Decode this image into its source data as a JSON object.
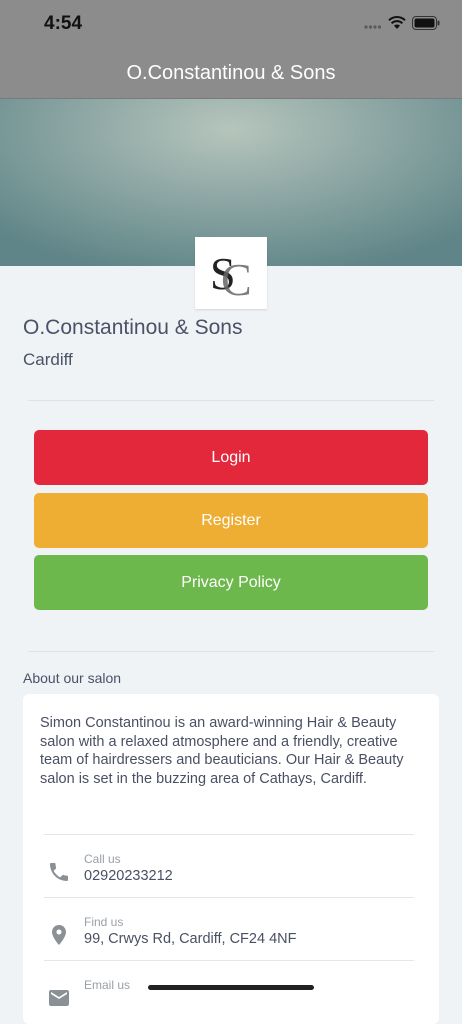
{
  "status": {
    "time": "4:54"
  },
  "header": {
    "title": "O.Constantinou & Sons"
  },
  "salon": {
    "name": "O.Constantinou & Sons",
    "city": "Cardiff",
    "logo_initials": "SC"
  },
  "buttons": {
    "login": {
      "label": "Login",
      "color": "#e3283c"
    },
    "register": {
      "label": "Register",
      "color": "#edae33"
    },
    "privacy": {
      "label": "Privacy Policy",
      "color": "#6cb84c"
    }
  },
  "about": {
    "heading": "About our salon",
    "text": "Simon Constantinou is an award-winning Hair & Beauty salon with a relaxed atmosphere and a friendly, creative team of hairdressers and beauticians. Our Hair & Beauty salon is set in the buzzing area of Cathays, Cardiff."
  },
  "contacts": [
    {
      "label": "Call us",
      "value": "02920233212",
      "icon": "phone-icon"
    },
    {
      "label": "Find us",
      "value": "99, Crwys Rd, Cardiff, CF24 4NF",
      "icon": "location-pin-icon"
    },
    {
      "label": "Email us",
      "value": "",
      "icon": "envelope-icon"
    }
  ]
}
